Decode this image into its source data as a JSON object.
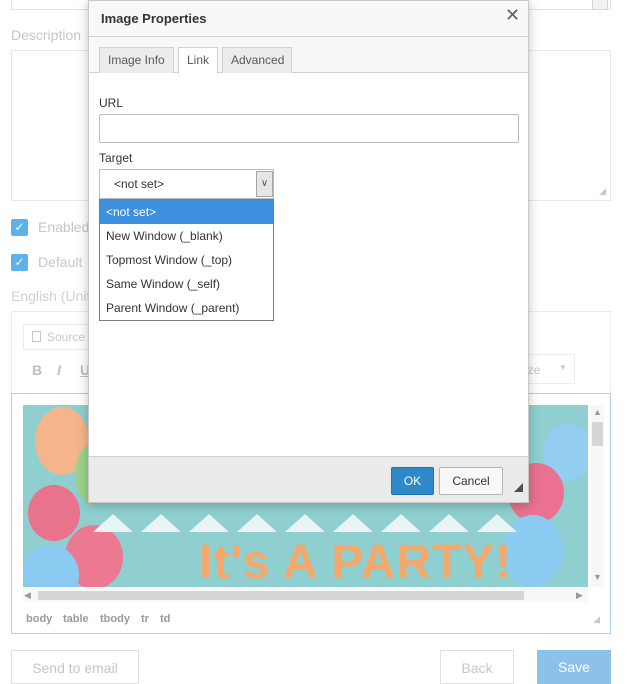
{
  "form": {
    "description_label": "Description",
    "enabled_label": "Enabled",
    "default_label": "Default",
    "language_label": "English (Unit",
    "source_label": "Source",
    "format_buttons": [
      "B",
      "I",
      "U"
    ],
    "size_label": "ize",
    "party_text": "It's A PARTY!",
    "element_path": [
      "body",
      "table",
      "tbody",
      "tr",
      "td"
    ],
    "send_label": "Send to email",
    "back_label": "Back",
    "save_label": "Save"
  },
  "dialog": {
    "title": "Image Properties",
    "close_glyph": "✕",
    "tabs": [
      {
        "label": "Image Info",
        "active": false
      },
      {
        "label": "Link",
        "active": true
      },
      {
        "label": "Advanced",
        "active": false
      }
    ],
    "url_label": "URL",
    "url_value": "",
    "target_label": "Target",
    "target_value": "<not set>",
    "target_options": [
      "<not set>",
      "New Window (_blank)",
      "Topmost Window (_top)",
      "Same Window (_self)",
      "Parent Window (_parent)"
    ],
    "ok_label": "OK",
    "cancel_label": "Cancel"
  },
  "colors": {
    "accent": "#2d89c8",
    "option_highlight": "#3d8fe0",
    "checkbox": "#5cb3ea"
  }
}
